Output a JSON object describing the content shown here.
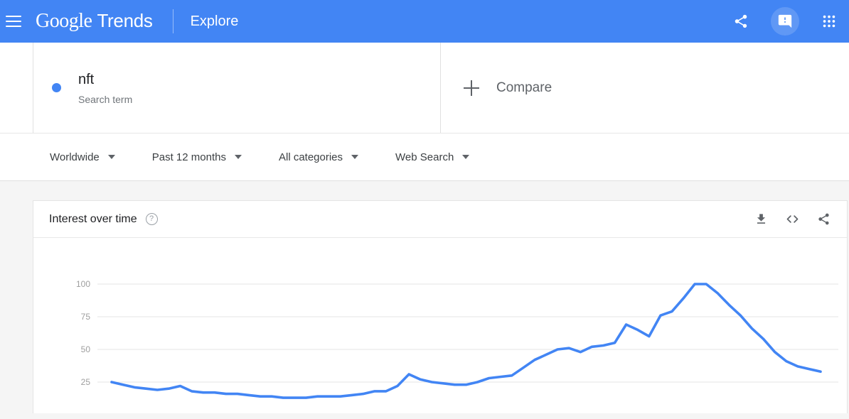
{
  "header": {
    "menu_icon": "hamburger-menu-icon",
    "brand_google": "Google",
    "brand_trends": "Trends",
    "explore": "Explore",
    "icons": [
      {
        "name": "share-icon",
        "label": "Share"
      },
      {
        "name": "feedback-icon",
        "label": "Send feedback"
      },
      {
        "name": "apps-grid-icon",
        "label": "Google apps"
      }
    ],
    "bg_color": "#4285f4"
  },
  "search": {
    "term": "nft",
    "term_type": "Search term",
    "dot_color": "#4285f4",
    "compare_label": "Compare",
    "compare_icon": "plus-icon"
  },
  "filters": [
    {
      "name": "location",
      "label": "Worldwide"
    },
    {
      "name": "time-range",
      "label": "Past 12 months"
    },
    {
      "name": "category",
      "label": "All categories"
    },
    {
      "name": "search-type",
      "label": "Web Search"
    }
  ],
  "card": {
    "title": "Interest over time",
    "help_glyph": "?",
    "actions": [
      {
        "name": "download-icon",
        "label": "Download CSV"
      },
      {
        "name": "embed-code-icon",
        "label": "Embed"
      },
      {
        "name": "share-icon",
        "label": "Share"
      }
    ]
  },
  "chart_data": {
    "type": "line",
    "title": "Interest over time",
    "xlabel": "",
    "ylabel": "",
    "ylim": [
      0,
      110
    ],
    "yticks": [
      25,
      50,
      75,
      100
    ],
    "ytick_labels": [
      "25",
      "50",
      "75",
      "100"
    ],
    "grid": true,
    "legend_position": "none",
    "line_color": "#4285f4",
    "series": [
      {
        "name": "nft",
        "values": [
          25,
          23,
          21,
          20,
          19,
          20,
          22,
          18,
          17,
          17,
          16,
          16,
          15,
          14,
          14,
          13,
          13,
          13,
          14,
          14,
          14,
          15,
          16,
          18,
          18,
          22,
          31,
          27,
          25,
          24,
          23,
          23,
          25,
          28,
          29,
          30,
          36,
          42,
          46,
          50,
          51,
          48,
          52,
          53,
          55,
          69,
          65,
          60,
          76,
          79,
          89,
          100,
          100,
          93,
          84,
          76,
          66,
          58,
          48,
          41,
          37,
          35,
          33
        ]
      }
    ],
    "x_count": 63,
    "max_value": 100,
    "min_value": 13
  }
}
